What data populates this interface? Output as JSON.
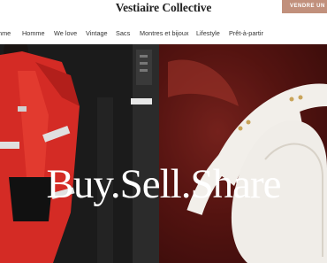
{
  "header": {
    "logo": "Vestiaire Collective",
    "sell_button": "VENDRE UN AR"
  },
  "nav": {
    "items": [
      "mme",
      "Homme",
      "We love",
      "Vintage",
      "Sacs",
      "Montres et bijoux",
      "Lifestyle",
      "Prêt-à-partir"
    ]
  },
  "hero": {
    "headline": "Buy.Sell.Share"
  },
  "colors": {
    "accent": "#c1907c"
  }
}
